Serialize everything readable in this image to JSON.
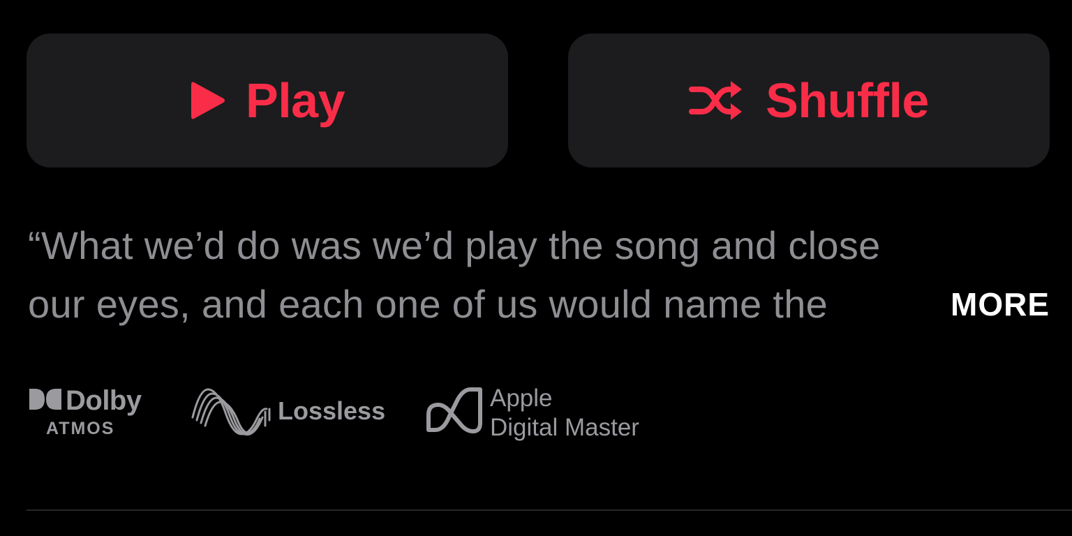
{
  "buttons": {
    "play_label": "Play",
    "shuffle_label": "Shuffle"
  },
  "description": {
    "line1": "“What we’d do was we’d play the song and close",
    "line2": "our eyes, and each one of us would name the",
    "more_label": "MORE"
  },
  "badges": {
    "dolby_word": "Dolby",
    "dolby_sub": "ATMOS",
    "lossless_label": "Lossless",
    "adm_line1": "Apple",
    "adm_line2": "Digital Master"
  },
  "colors": {
    "background": "#000000",
    "button_bg": "#1c1c1e",
    "accent": "#fa2d48",
    "secondary_text": "#8e8e93",
    "badge_gray": "#9a9a9f",
    "more_text": "#ffffff"
  },
  "icons": {
    "play": "play-icon",
    "shuffle": "shuffle-icon",
    "dolby": "dolby-logo-icon",
    "lossless": "lossless-wave-icon",
    "adm": "apple-digital-master-icon"
  }
}
